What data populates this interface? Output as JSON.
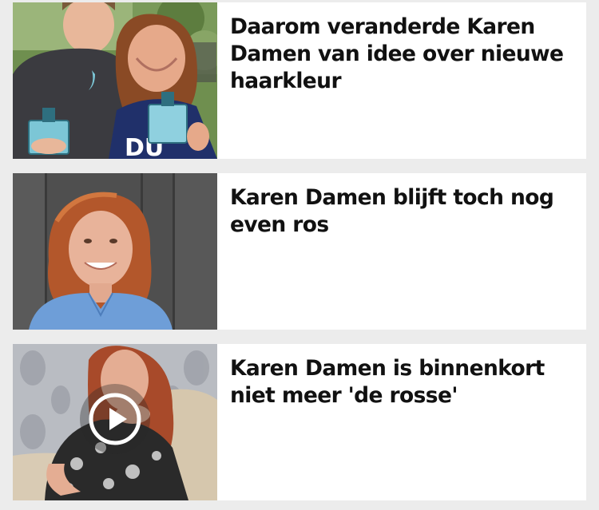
{
  "articles": [
    {
      "headline": "Daarom veranderde Karen Damen van idee over nieuwe haarkleur",
      "image": "photo-woman-and-man-holding-bottles",
      "has_video": false
    },
    {
      "headline": "Karen Damen blijft toch nog even ros",
      "image": "photo-red-haired-woman-blue-blouse",
      "has_video": false
    },
    {
      "headline": "Karen Damen is binnenkort niet meer 'de rosse'",
      "image": "photo-red-haired-woman-on-couch",
      "has_video": true,
      "video_icon": "play-icon"
    }
  ],
  "colors": {
    "background": "#ececec",
    "card": "#ffffff",
    "headline_text": "#111111"
  }
}
